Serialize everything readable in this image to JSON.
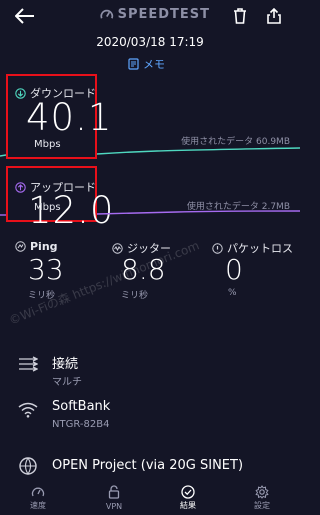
{
  "header": {
    "brand": "SPEEDTEST",
    "icons": [
      "back-arrow-icon",
      "speedometer-logo-icon",
      "trash-icon",
      "share-icon"
    ]
  },
  "datetime": "2020/03/18 17:19",
  "memo_label": "メモ",
  "download": {
    "label": "ダウンロード",
    "value": "40.1",
    "unit": "Mbps",
    "usage": "使用されたデータ 60.9MB",
    "color": "#4fd8c0"
  },
  "upload": {
    "label": "アップロード",
    "value": "12.0",
    "unit": "Mbps",
    "usage": "使用されたデータ 2.7MB",
    "color": "#a66bf0"
  },
  "metrics": {
    "ping": {
      "label": "Ping",
      "value": "33",
      "unit": "ミリ秒"
    },
    "jitter": {
      "label": "ジッター",
      "value": "8.8",
      "unit": "ミリ秒"
    },
    "packet_loss": {
      "label": "パケットロス",
      "value": "0",
      "unit": "%"
    }
  },
  "connection": {
    "title": "接続",
    "subtitle": "マルチ"
  },
  "network": {
    "title": "SoftBank",
    "subtitle": "NTGR-82B4"
  },
  "server": {
    "title": "OPEN Project (via 20G SINET)"
  },
  "nav": {
    "speed": "速度",
    "vpn": "VPN",
    "results": "結果",
    "settings": "設定"
  },
  "watermark": "©Wi-Fiの森 https://wifinomori.com",
  "highlight_color": "#e8101a"
}
